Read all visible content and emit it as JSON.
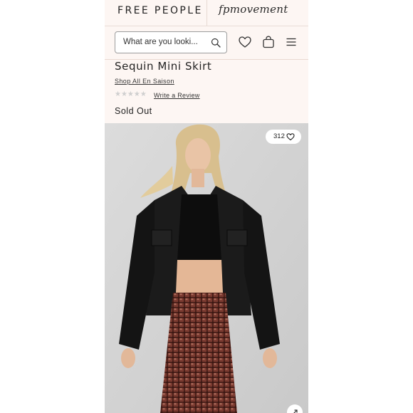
{
  "brand": {
    "name": "FREE PEOPLE",
    "sub_brand": "fpmovement"
  },
  "search": {
    "placeholder": "What are you looki..."
  },
  "product": {
    "title": "Sequin Mini Skirt",
    "collection_link": "Shop All En Saison",
    "rating_stars": "★★★★★",
    "review_link": "Write a Review",
    "availability": "Sold Out"
  },
  "gallery": {
    "favorites_count": "312"
  },
  "icons": {
    "search": "search-icon",
    "wishlist": "heart-icon",
    "bag": "shopping-bag-icon",
    "menu": "hamburger-menu-icon",
    "favorite": "heart-icon",
    "expand": "expand-icon"
  },
  "colors": {
    "page_background": "#fdf6f3",
    "text": "#222222",
    "rating_empty": "#cfcfcf",
    "photo_background": "#d6d6d6"
  }
}
